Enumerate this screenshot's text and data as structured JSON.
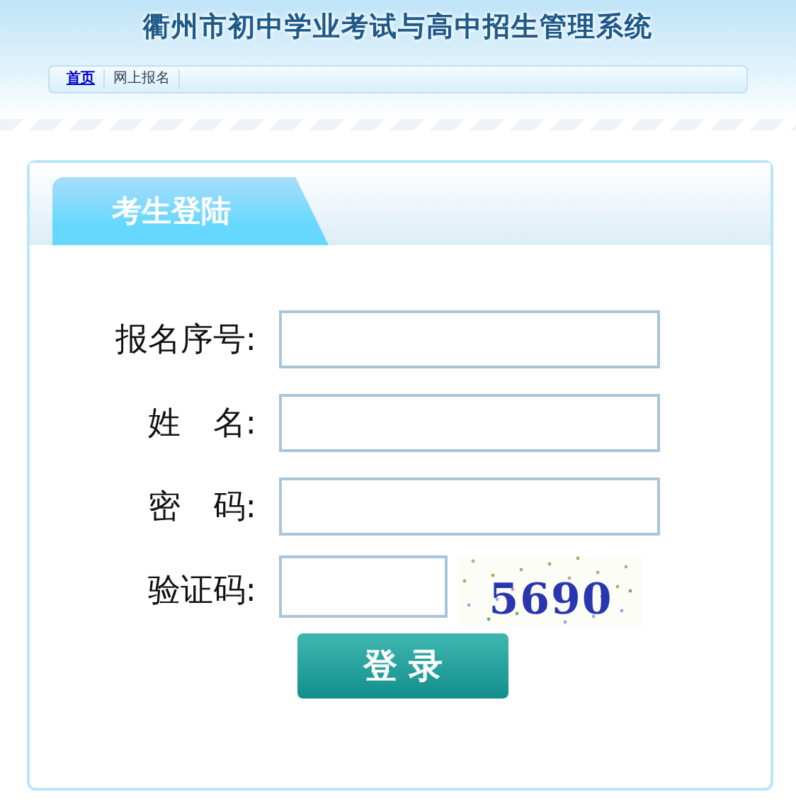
{
  "header": {
    "title": "衢州市初中学业考试与高中招生管理系统"
  },
  "nav": [
    {
      "label": "首页",
      "selected": true
    },
    {
      "label": "网上报名",
      "selected": false
    }
  ],
  "panel": {
    "tab": "考生登陆"
  },
  "fields": [
    {
      "kind": "text",
      "label": "报名序号:"
    },
    {
      "kind": "text",
      "label": "姓　名:"
    },
    {
      "kind": "password",
      "label": "密　码:"
    },
    {
      "kind": "captcha",
      "label": "验证码:",
      "code": "5690"
    }
  ],
  "button": "登 录"
}
